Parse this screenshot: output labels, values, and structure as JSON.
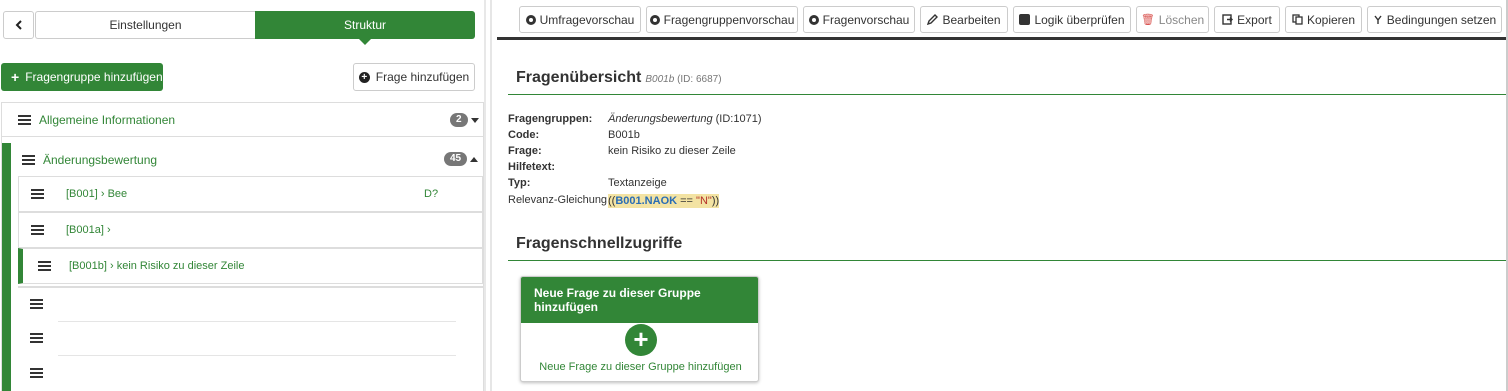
{
  "sidebar": {
    "tabs": {
      "settings": "Einstellungen",
      "structure": "Struktur"
    },
    "add_group_label": "Fragengruppe hinzufügen",
    "add_question_label": "Frage hinzufügen",
    "groups": [
      {
        "label": "Allgemeine Informationen",
        "count": "2"
      },
      {
        "label": "Änderungsbewertung",
        "count": "45"
      }
    ],
    "questions": [
      {
        "label": "[B001] › Bee",
        "extra": "D?"
      },
      {
        "label": "[B001a] ›"
      },
      {
        "label": "[B001b] › kein Risiko zu dieser Zeile"
      }
    ]
  },
  "toolbar": {
    "survey_preview": "Umfragevorschau",
    "group_preview": "Fragengruppenvorschau",
    "question_preview": "Fragenvorschau",
    "edit": "Bearbeiten",
    "check_logic": "Logik überprüfen",
    "delete": "Löschen",
    "export": "Export",
    "copy": "Kopieren",
    "set_conditions": "Bedingungen setzen"
  },
  "overview": {
    "title": "Fragenübersicht",
    "code": "B001b",
    "id_text": "(ID: 6687)",
    "fields": {
      "group_label": "Fragengruppen:",
      "group_name": "Änderungsbewertung",
      "group_id": "(ID:1071)",
      "code_label": "Code:",
      "code_value": "B001b",
      "question_label": "Frage:",
      "question_value": "kein Risiko zu dieser Zeile",
      "help_label": "Hilfetext:",
      "type_label": "Typ:",
      "type_value": "Textanzeige",
      "relevance_label": "Relevanz-Gleichung:",
      "eq_open": "((",
      "eq_var": "B001.NAOK",
      "eq_op": " == ",
      "eq_str": "\"N\"",
      "eq_close": "))"
    }
  },
  "quick_access": {
    "title": "Fragenschnellzugriffe",
    "card_title": "Neue Frage zu dieser Gruppe hinzufügen",
    "card_text": "Neue Frage zu dieser Gruppe hinzufügen"
  },
  "colors": {
    "brand_green": "#328637",
    "badge_gray": "#777777",
    "equation_bg": "#f3e3a3"
  }
}
